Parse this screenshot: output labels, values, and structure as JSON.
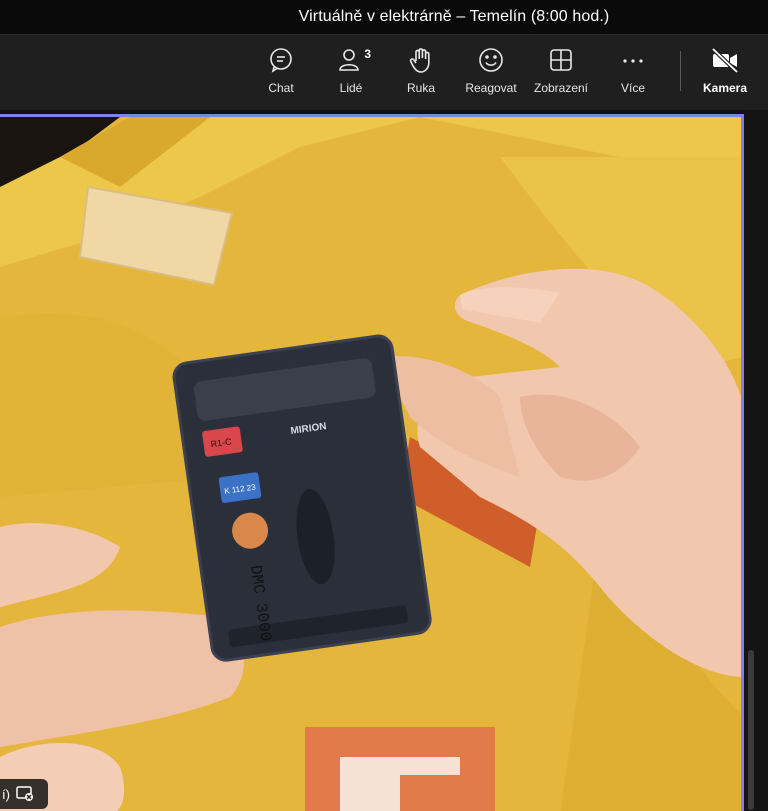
{
  "window": {
    "title": "Virtuálně v elektrárně – Temelín (8:00 hod.)"
  },
  "toolbar": {
    "buttons": [
      {
        "id": "chat",
        "label": "Chat",
        "icon": "chat-icon"
      },
      {
        "id": "people",
        "label": "Lidé",
        "icon": "people-icon",
        "badge": "3"
      },
      {
        "id": "hand",
        "label": "Ruka",
        "icon": "raise-hand-icon"
      },
      {
        "id": "react",
        "label": "Reagovat",
        "icon": "smile-icon"
      },
      {
        "id": "view",
        "label": "Zobrazení",
        "icon": "grid-view-icon"
      },
      {
        "id": "more",
        "label": "Více",
        "icon": "more-icon"
      },
      {
        "id": "camera",
        "label": "Kamera",
        "icon": "camera-off-icon"
      }
    ]
  },
  "video": {
    "dosimeter_brand": "MIRION",
    "dosimeter_model": "DMC 3000",
    "tag_red": "R1-C",
    "tag_blue": "K 112 23"
  },
  "overlay": {
    "fragment": "í)"
  },
  "colors": {
    "accent": "#7b83eb",
    "toolbar": "#1f1f1f",
    "suit": "#e6b93a"
  }
}
